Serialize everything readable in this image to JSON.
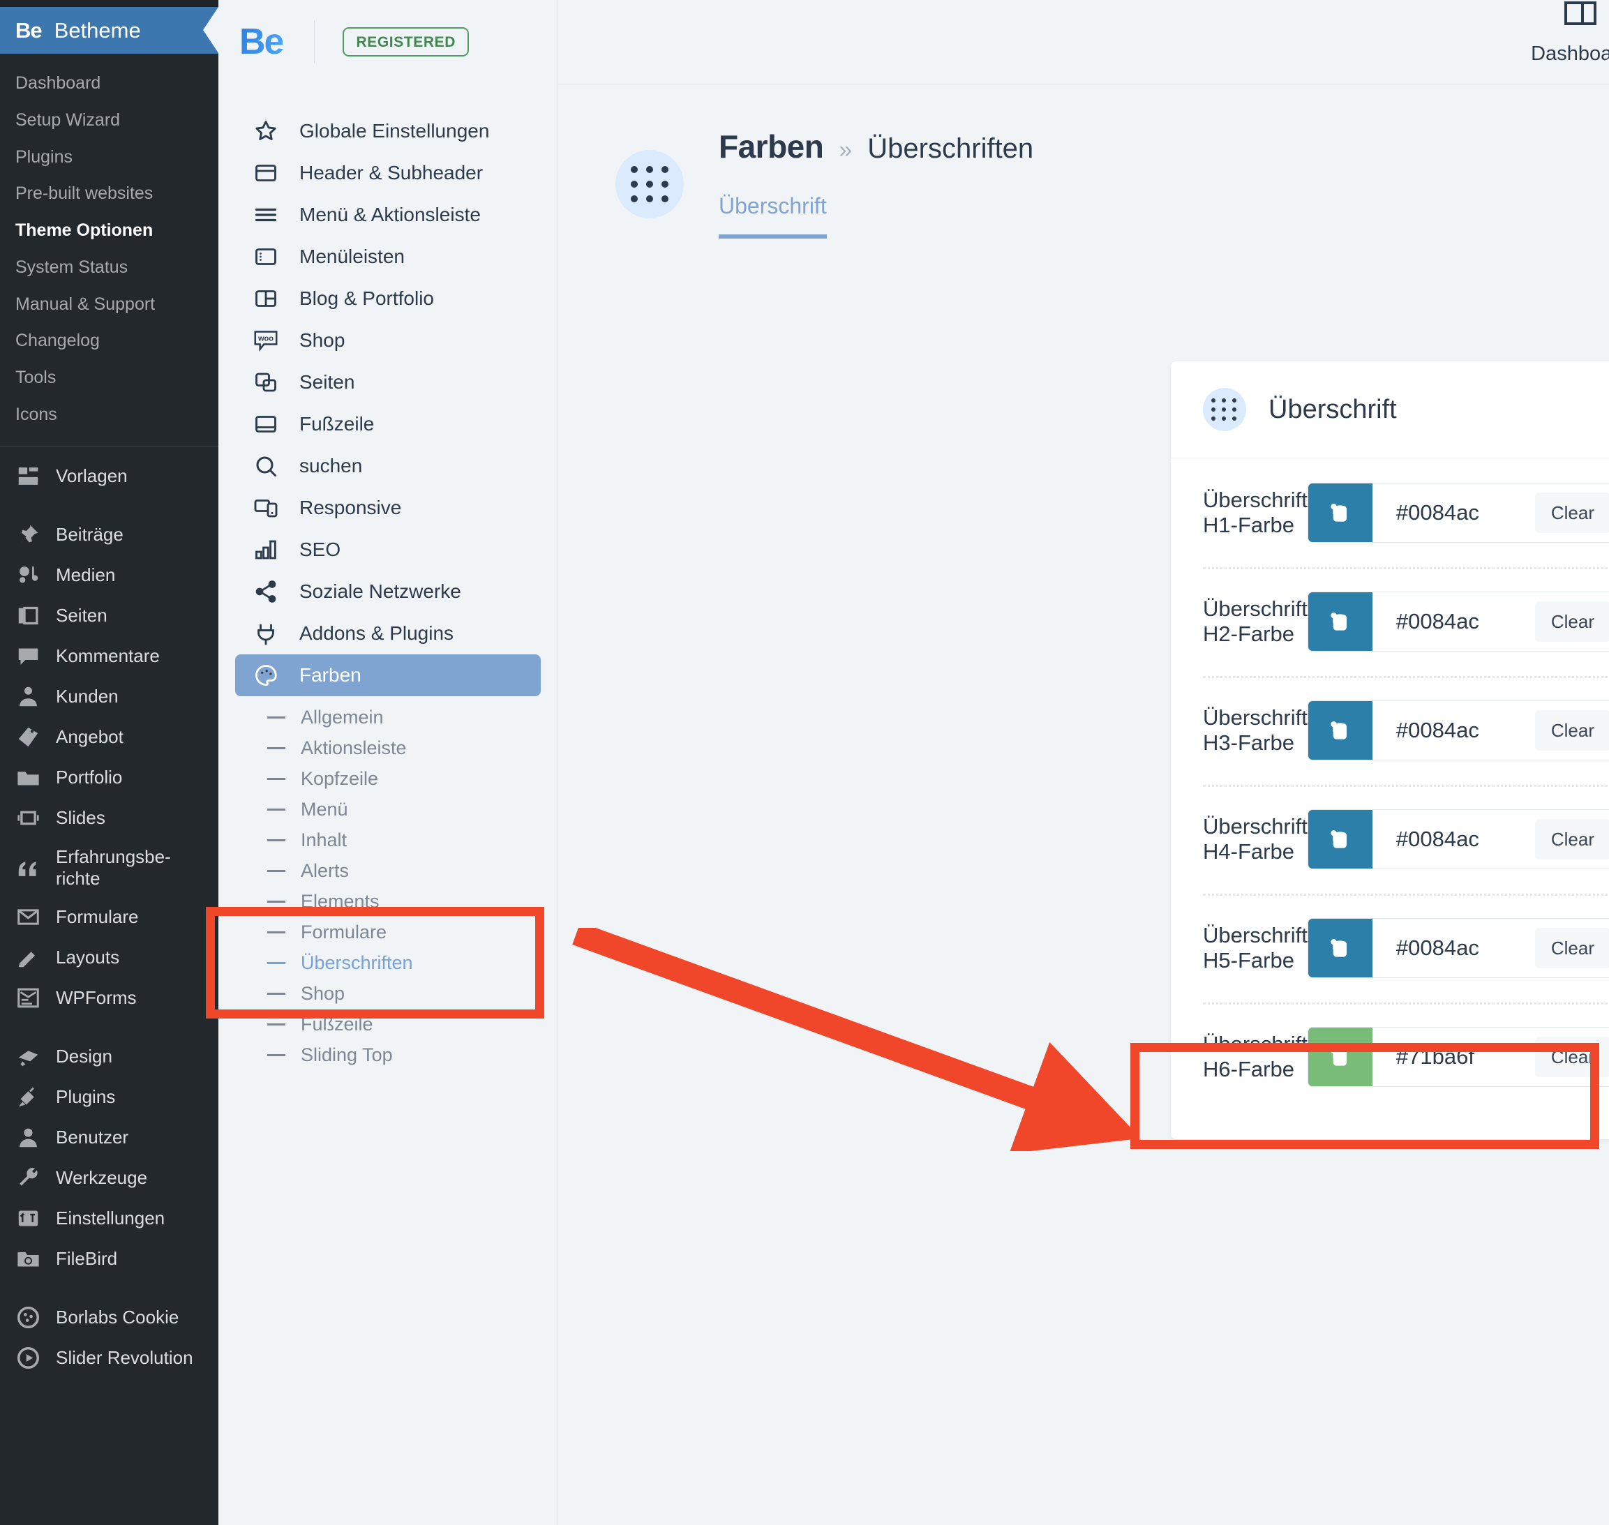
{
  "wp_sidebar": {
    "brand": {
      "mark": "Be",
      "name": "Betheme"
    },
    "be_subitems": [
      {
        "label": "Dashboard",
        "active": false
      },
      {
        "label": "Setup Wizard",
        "active": false
      },
      {
        "label": "Plugins",
        "active": false
      },
      {
        "label": "Pre-built websites",
        "active": false
      },
      {
        "label": "Theme Optionen",
        "active": true
      },
      {
        "label": "System Status",
        "active": false
      },
      {
        "label": "Manual & Support",
        "active": false
      },
      {
        "label": "Changelog",
        "active": false
      },
      {
        "label": "Tools",
        "active": false
      },
      {
        "label": "Icons",
        "active": false
      }
    ],
    "menu_groups": [
      {
        "items": [
          {
            "label": "Vorlagen",
            "icon": "templates-icon"
          }
        ]
      },
      {
        "items": [
          {
            "label": "Beiträge",
            "icon": "pin-icon"
          },
          {
            "label": "Medien",
            "icon": "media-icon"
          },
          {
            "label": "Seiten",
            "icon": "pages-icon"
          },
          {
            "label": "Kommentare",
            "icon": "comment-icon"
          },
          {
            "label": "Kunden",
            "icon": "customers-icon"
          },
          {
            "label": "Angebot",
            "icon": "offer-tag-icon"
          },
          {
            "label": "Portfolio",
            "icon": "folder-icon"
          },
          {
            "label": "Slides",
            "icon": "slides-icon"
          },
          {
            "label": "Erfahrungsbe-<br>richte",
            "icon": "quote-icon"
          },
          {
            "label": "Formulare",
            "icon": "envelope-icon"
          },
          {
            "label": "Layouts",
            "icon": "pencil-icon"
          },
          {
            "label": "WPForms",
            "icon": "wpforms-icon"
          }
        ]
      },
      {
        "items": [
          {
            "label": "Design",
            "icon": "brush-icon"
          },
          {
            "label": "Plugins",
            "icon": "plug-icon"
          },
          {
            "label": "Benutzer",
            "icon": "user-icon"
          },
          {
            "label": "Werkzeuge",
            "icon": "wrench-icon"
          },
          {
            "label": "Einstellungen",
            "icon": "settings-icon"
          },
          {
            "label": "FileBird",
            "icon": "filebird-icon"
          }
        ]
      },
      {
        "items": [
          {
            "label": "Borlabs Cookie",
            "icon": "borlabs-cookie-icon"
          },
          {
            "label": "Slider Revolution",
            "icon": "slider-revolution-icon"
          }
        ]
      }
    ]
  },
  "be_panel": {
    "logo_text": "Be",
    "badge": "REGISTERED",
    "nav": [
      {
        "label": "Globale Einstellungen",
        "icon": "star-icon",
        "selected": false
      },
      {
        "label": "Header & Subheader",
        "icon": "header-icon",
        "selected": false
      },
      {
        "label": "Menü & Aktionsleiste",
        "icon": "hamburger-icon",
        "selected": false
      },
      {
        "label": "Menüleisten",
        "icon": "sidebar-icon",
        "selected": false
      },
      {
        "label": "Blog & Portfolio",
        "icon": "layout-columns-icon",
        "selected": false
      },
      {
        "label": "Shop",
        "icon": "woo-icon",
        "selected": false
      },
      {
        "label": "Seiten",
        "icon": "copy-pages-icon",
        "selected": false
      },
      {
        "label": "Fußzeile",
        "icon": "footer-icon",
        "selected": false
      },
      {
        "label": "suchen",
        "icon": "search-icon",
        "selected": false
      },
      {
        "label": "Responsive",
        "icon": "responsive-icon",
        "selected": false
      },
      {
        "label": "SEO",
        "icon": "bar-chart-icon",
        "selected": false
      },
      {
        "label": "Soziale Netzwerke",
        "icon": "share-icon",
        "selected": false
      },
      {
        "label": "Addons & Plugins",
        "icon": "plug-icon",
        "selected": false
      },
      {
        "label": "Farben",
        "icon": "palette-icon",
        "selected": true
      }
    ],
    "sub_items": [
      {
        "label": "Allgemein",
        "current": false
      },
      {
        "label": "Aktionsleiste",
        "current": false
      },
      {
        "label": "Kopfzeile",
        "current": false
      },
      {
        "label": "Menü",
        "current": false
      },
      {
        "label": "Inhalt",
        "current": false
      },
      {
        "label": "Alerts",
        "current": false
      },
      {
        "label": "Elements",
        "current": false
      },
      {
        "label": "Formulare",
        "current": false
      },
      {
        "label": "Überschriften",
        "current": true
      },
      {
        "label": "Shop",
        "current": false
      },
      {
        "label": "Fußzeile",
        "current": false
      },
      {
        "label": "Sliding Top",
        "current": false
      }
    ]
  },
  "main": {
    "top_right_label": "Dashboard",
    "breadcrumb": {
      "parent": "Farben",
      "separator": "»",
      "current": "Überschriften"
    },
    "tab_label": "Überschrift",
    "card": {
      "title": "Überschrift",
      "clear_label": "Clear",
      "rows": [
        {
          "label": "Überschrift H1-Farbe",
          "value": "#0084ac",
          "swatch": "#2b7fa8"
        },
        {
          "label": "Überschrift H2-Farbe",
          "value": "#0084ac",
          "swatch": "#2b7fa8"
        },
        {
          "label": "Überschrift H3-Farbe",
          "value": "#0084ac",
          "swatch": "#2b7fa8"
        },
        {
          "label": "Überschrift H4-Farbe",
          "value": "#0084ac",
          "swatch": "#2b7fa8"
        },
        {
          "label": "Überschrift H5-Farbe",
          "value": "#0084ac",
          "swatch": "#2b7fa8"
        },
        {
          "label": "Überschrift H6-Farbe",
          "value": "#71ba6f",
          "swatch": "#79bc78"
        }
      ]
    }
  },
  "annotation": {
    "color": "#f0462a",
    "highlight_targets": [
      "Farben",
      "Überschrift H6-Farbe"
    ]
  },
  "theme_colors": {
    "wp_sidebar_bg": "#23282d",
    "betheme_blue": "#3d77b0",
    "panel_bg": "#f1f4f7",
    "selected_nav": "#7fa4d2",
    "accent_link": "#76a1d4",
    "annotation_red": "#f0462a"
  }
}
